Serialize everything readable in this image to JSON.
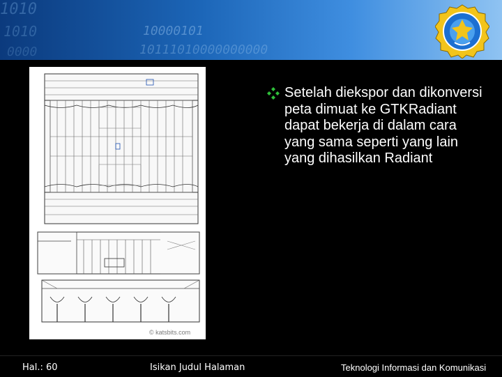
{
  "slide": {
    "bullet_text": "Setelah diekspor dan dikonversi peta dimuat ke GTKRadiant dapat bekerja di dalam cara yang sama seperti yang lain yang dihasilkan Radiant",
    "watermark": "© katsbits.com",
    "header_binary_lines": [
      "1010",
      "10000101",
      "10111010000000000",
      "1010",
      "0000"
    ],
    "logo_text": "TUT WURI HANDAYANI"
  },
  "footer": {
    "page": "Hal.: 60",
    "title": "Isikan Judul Halaman",
    "right": "Teknologi Informasi dan Komunikasi"
  },
  "colors": {
    "background": "#000000",
    "header_start": "#0b3a7d",
    "header_end": "#8fc3f2",
    "bullet": "#2fbf3a",
    "text": "#ffffff"
  },
  "icons": {
    "bullet": "four-diamond-bullet-icon",
    "logo": "tut-wuri-handayani-logo"
  }
}
